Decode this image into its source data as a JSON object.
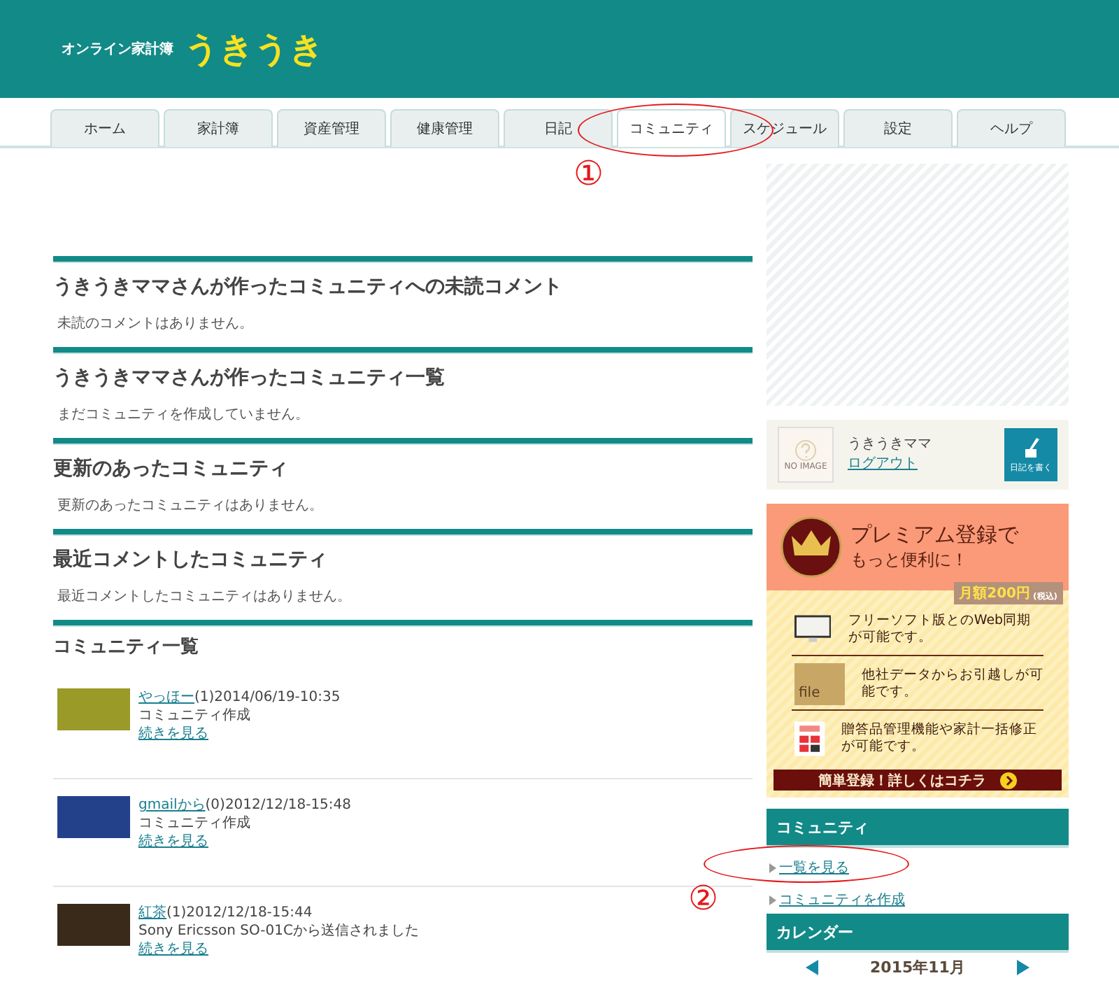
{
  "header": {
    "tagline": "オンライン家計簿",
    "logo": "うきうき"
  },
  "tabs": [
    {
      "label": "ホーム",
      "selected": false
    },
    {
      "label": "家計簿",
      "selected": false
    },
    {
      "label": "資産管理",
      "selected": false
    },
    {
      "label": "健康管理",
      "selected": false
    },
    {
      "label": "日記",
      "selected": false
    },
    {
      "label": "コミュニティ",
      "selected": true
    },
    {
      "label": "スケジュール",
      "selected": false
    },
    {
      "label": "設定",
      "selected": false
    },
    {
      "label": "ヘルプ",
      "selected": false
    }
  ],
  "sections": [
    {
      "title": "うきうきママさんが作ったコミュニティへの未読コメント",
      "message": "未読のコメントはありません。"
    },
    {
      "title": "うきうきママさんが作ったコミュニティ一覧",
      "message": "まだコミュニティを作成していません。"
    },
    {
      "title": "更新のあったコミュニティ",
      "message": "更新のあったコミュニティはありません。"
    },
    {
      "title": "最近コメントしたコミュニティ",
      "message": "最近コメントしたコミュニティはありません。"
    }
  ],
  "community_list": {
    "title": "コミュニティ一覧",
    "items": [
      {
        "name": "やっほー",
        "meta": "(1)2014/06/19-10:35",
        "description": "コミュニティ作成",
        "link": "続きを見る",
        "color": "#9a9a28"
      },
      {
        "name": "gmailから",
        "meta": "(0)2012/12/18-15:48",
        "description": "コミュニティ作成",
        "link": "続きを見る",
        "color": "#23408a"
      },
      {
        "name": "紅茶",
        "meta": "(1)2012/12/18-15:44",
        "description": "Sony Ericsson SO-01Cから送信されました",
        "link": "続きを見る",
        "color": "#3a2a1a"
      }
    ]
  },
  "sidebar": {
    "user": {
      "no_image": "NO IMAGE",
      "name": "うきうきママ",
      "logout": "ログアウト",
      "write_button": "日記を書く"
    },
    "premium": {
      "title": "プレミアム登録で",
      "subtitle": "もっと便利に！",
      "price": "月額200円",
      "tax": "(税込)",
      "features": [
        {
          "kind": "monitor",
          "text": "フリーソフト版とのWeb同期が可能です。"
        },
        {
          "kind": "file",
          "label": "file",
          "text": "他社データからお引越しが可能です。"
        },
        {
          "kind": "calculator",
          "text": "贈答品管理機能や家計一括修正が可能です。"
        }
      ],
      "cta": "簡単登録！詳しくはコチラ"
    },
    "community": {
      "title": "コミュニティ",
      "links": [
        "一覧を見る",
        "コミュニティを作成"
      ]
    },
    "calendar": {
      "title": "カレンダー",
      "month": "2015年11月"
    }
  },
  "annotations": [
    {
      "label": "①"
    },
    {
      "label": "②"
    }
  ]
}
